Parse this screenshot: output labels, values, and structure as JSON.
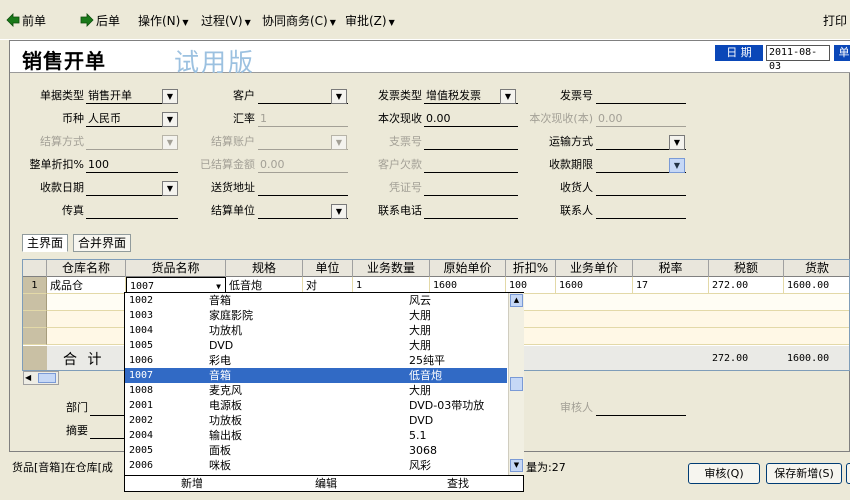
{
  "toolbar": {
    "prev": "前单",
    "next": "后单",
    "operate": "操作(N)",
    "process": "过程(V)",
    "collab": "协同商务(C)",
    "approve": "审批(Z)",
    "print": "打印"
  },
  "header": {
    "title": "销售开单",
    "trial": "试用版",
    "date_label": "日 期",
    "date_value": "2011-08-03",
    "side_btn": "单"
  },
  "form": {
    "doc_type_label": "单据类型",
    "doc_type_value": "销售开单",
    "customer_label": "客户",
    "customer_value": "",
    "invoice_type_label": "发票类型",
    "invoice_type_value": "增值税发票",
    "invoice_no_label": "发票号",
    "invoice_no_value": "",
    "currency_label": "币种",
    "currency_value": "人民币",
    "rate_label": "汇率",
    "rate_value": "1",
    "cur_recv_label": "本次现收",
    "cur_recv_value": "0.00",
    "cur_recv_fc_label": "本次现收(本)",
    "cur_recv_fc_value": "0.00",
    "settle_method_label": "结算方式",
    "settle_method_value": "",
    "settle_account_label": "结算账户",
    "settle_account_value": "",
    "cheque_label": "支票号",
    "cheque_value": "",
    "carrier_label": "运输方式",
    "carrier_value": "",
    "discount_label": "整单折扣%",
    "discount_value": "100",
    "settled_label": "已结算金额",
    "settled_value": "0.00",
    "owed_label": "客户欠款",
    "owed_value": "",
    "due_label": "收款期限",
    "due_value": "",
    "recv_date_label": "收款日期",
    "recv_date_value": "",
    "ship_addr_label": "送货地址",
    "ship_addr_value": "",
    "voucher_label": "凭证号",
    "voucher_value": "",
    "consignee_label": "收货人",
    "consignee_value": "",
    "fax_label": "传真",
    "fax_value": "",
    "settle_unit_label": "结算单位",
    "settle_unit_value": "",
    "phone_label": "联系电话",
    "phone_value": "",
    "contact_label": "联系人",
    "contact_value": ""
  },
  "tabs": [
    "主界面",
    "合并界面"
  ],
  "grid": {
    "columns": [
      "仓库名称",
      "货品名称",
      "规格",
      "单位",
      "业务数量",
      "原始单价",
      "折扣%",
      "业务单价",
      "税率",
      "税额",
      "货款"
    ],
    "row": {
      "index": "1",
      "warehouse": "成品仓",
      "item": "1007",
      "spec": "低音炮",
      "unit": "对",
      "qty": "1",
      "orig_price": "1600",
      "discount": "100",
      "price": "1600",
      "tax_rate": "17",
      "tax": "272.00",
      "amount": "1600.00"
    },
    "total_label": "合 计",
    "total_tax": "272.00",
    "total_amount": "1600.00"
  },
  "popup": {
    "items": [
      {
        "code": "1002",
        "name": "音箱",
        "spec": "风云"
      },
      {
        "code": "1003",
        "name": "家庭影院",
        "spec": "大朋"
      },
      {
        "code": "1004",
        "name": "功放机",
        "spec": "大朋"
      },
      {
        "code": "1005",
        "name": "DVD",
        "spec": "大朋"
      },
      {
        "code": "1006",
        "name": "彩电",
        "spec": "25纯平"
      },
      {
        "code": "1007",
        "name": "音箱",
        "spec": "低音炮"
      },
      {
        "code": "1008",
        "name": "麦克风",
        "spec": "大朋"
      },
      {
        "code": "2001",
        "name": "电源板",
        "spec": "DVD-03带功放"
      },
      {
        "code": "2002",
        "name": "功放板",
        "spec": "DVD"
      },
      {
        "code": "2004",
        "name": "输出板",
        "spec": "5.1"
      },
      {
        "code": "2005",
        "name": "面板",
        "spec": "3068"
      },
      {
        "code": "2006",
        "name": "咪板",
        "spec": "风彩"
      }
    ],
    "selected_index": 5,
    "footer": {
      "add": "新增",
      "edit": "编辑",
      "find": "查找"
    }
  },
  "bottom": {
    "dept_label": "部门",
    "memo_label": "摘要",
    "reviewer_label": "审核人",
    "status_left": "货品[音箱]在仓库[成",
    "status_right": "量为:27",
    "audit_btn": "审核(Q)",
    "save_new_btn": "保存新增(S)"
  },
  "colors": {
    "accent": "#316ac5",
    "date_bg": "#0a47b8",
    "trial": "#9cc1e0"
  }
}
